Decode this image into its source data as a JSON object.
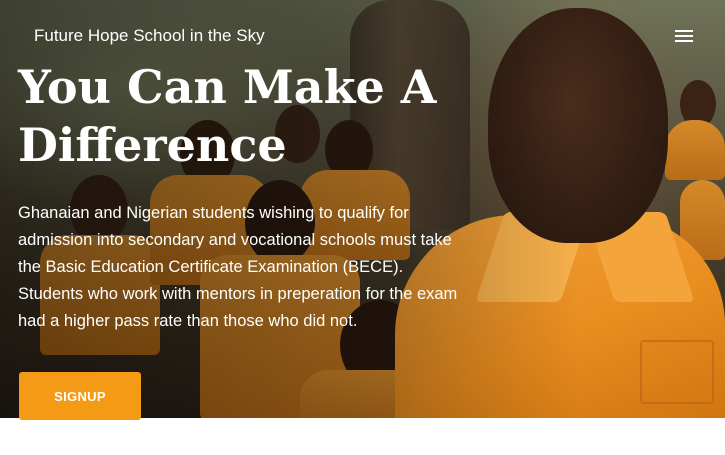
{
  "header": {
    "brand": "Future Hope School in the Sky",
    "menu_icon": "hamburger-menu-icon"
  },
  "hero": {
    "title": "You Can Make A Difference",
    "description": "Ghanaian and Nigerian students wishing to qualify for admission into secondary and vocational schools must take the Basic Education Certificate Examination (BECE). Students who work with mentors in preperation for the exam had a higher pass rate than those who did not.",
    "signup_label": "SIGNUP",
    "accent_color": "#f49a15",
    "image_subject": "schoolchildren in orange uniforms"
  }
}
